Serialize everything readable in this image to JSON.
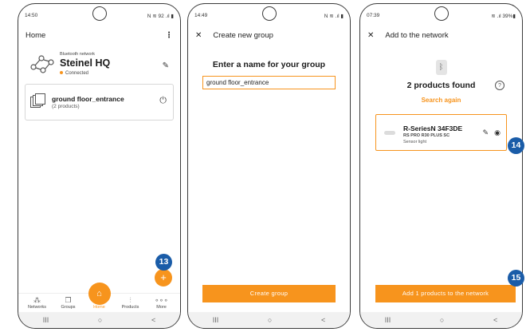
{
  "colors": {
    "accent": "#f7941d",
    "badge": "#1a5ca8"
  },
  "phone1": {
    "status_time": "14:50",
    "status_icons": "N ≋ 92 .ıl ▮",
    "title": "Home",
    "menu_icon": "⋮",
    "network_sub": "Bluetooth network",
    "network_name": "Steinel HQ",
    "network_status": "Connected",
    "group_name": "ground floor_entrance",
    "group_count": "(2 products)",
    "fab_symbol": "+",
    "nav": [
      "Networks",
      "Groups",
      "Home",
      "Products",
      "More"
    ]
  },
  "phone2": {
    "status_time": "14:49",
    "status_icons": "N ≋ .ıl ▮",
    "close_symbol": "✕",
    "title": "Create new group",
    "prompt": "Enter a name for your group",
    "input_value": "ground floor_entrance",
    "button": "Create group"
  },
  "phone3": {
    "status_time": "07:39",
    "status_icons": "≋ .ıl 39%▮",
    "close_symbol": "✕",
    "title": "Add to the network",
    "found": "2 products found",
    "help_symbol": "?",
    "search_again": "Search again",
    "product_name": "R-SeriesN 34F3DE",
    "product_model": "RS PRO R30 PLUS SC",
    "product_type": "Sensor light",
    "button": "Add 1 products to the network"
  },
  "navbar": [
    "III",
    "○",
    "<"
  ],
  "badges": [
    "13",
    "14",
    "15"
  ]
}
